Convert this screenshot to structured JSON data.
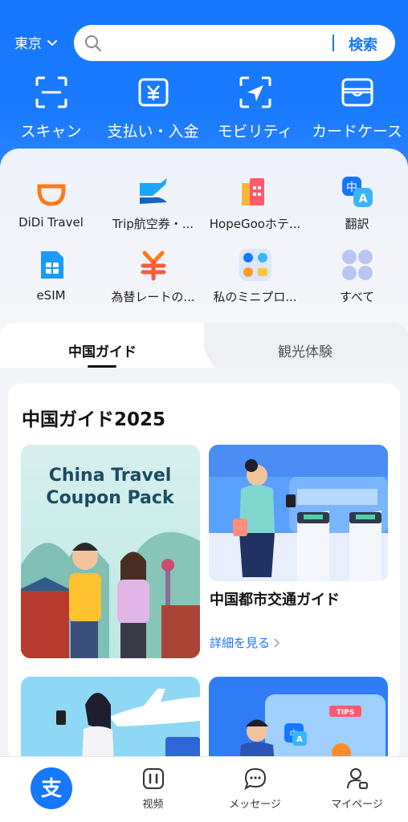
{
  "header": {
    "city": "東京",
    "search_placeholder": "",
    "search_button": "検索"
  },
  "quick_actions": [
    {
      "label": "スキャン",
      "icon": "scan-icon"
    },
    {
      "label": "支払い・入金",
      "icon": "yen-pay-icon"
    },
    {
      "label": "モビリティ",
      "icon": "mobility-arrow-icon"
    },
    {
      "label": "カードケース",
      "icon": "card-case-icon"
    }
  ],
  "apps": [
    {
      "label": "DiDi Travel",
      "icon": "didi-icon"
    },
    {
      "label": "Trip航空券・...",
      "icon": "plane-ticket-icon"
    },
    {
      "label": "HopeGooホテ...",
      "icon": "hotel-icon"
    },
    {
      "label": "翻訳",
      "icon": "translate-icon"
    },
    {
      "label": "eSIM",
      "icon": "esim-icon"
    },
    {
      "label": "為替レートの...",
      "icon": "exchange-rate-icon"
    },
    {
      "label": "私のミニプロ...",
      "icon": "mini-program-icon"
    },
    {
      "label": "すべて",
      "icon": "all-apps-icon"
    }
  ],
  "tabs": [
    {
      "label": "中国ガイド",
      "active": true
    },
    {
      "label": "観光体験",
      "active": false
    }
  ],
  "section": {
    "title": "中国ガイド2025",
    "coupon_line1": "China Travel",
    "coupon_line2": "Coupon Pack",
    "guide_title": "中国都市交通ガイド",
    "guide_more": "詳細を見る",
    "tips_badge": "TIPS"
  },
  "tabbar": [
    {
      "label": "",
      "icon": "alipay-home-icon"
    },
    {
      "label": "视频",
      "icon": "video-icon"
    },
    {
      "label": "メッセージ",
      "icon": "message-icon"
    },
    {
      "label": "マイページ",
      "icon": "profile-icon"
    }
  ],
  "colors": {
    "brand_blue": "#1677ff",
    "didi_orange": "#ff7a1a"
  }
}
